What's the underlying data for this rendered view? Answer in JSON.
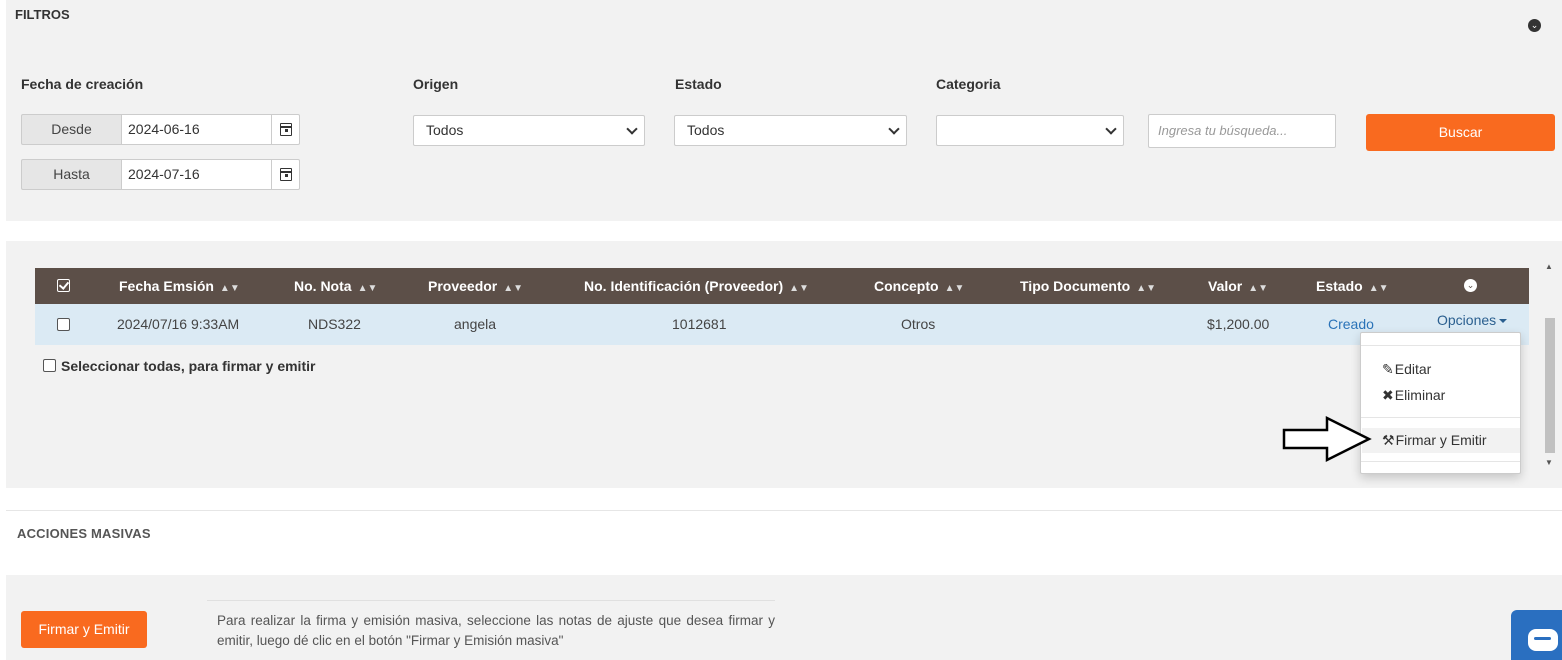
{
  "filters": {
    "title": "FILTROS",
    "fecha_label": "Fecha de creación",
    "desde_label": "Desde",
    "desde_value": "2024-06-16",
    "hasta_label": "Hasta",
    "hasta_value": "2024-07-16",
    "origen_label": "Origen",
    "origen_value": "Todos",
    "estado_label": "Estado",
    "estado_value": "Todos",
    "categoria_label": "Categoria",
    "categoria_value": "",
    "search_placeholder": "Ingresa tu búsqueda...",
    "buscar_label": "Buscar"
  },
  "table": {
    "columns": [
      "Fecha Emsión",
      "No. Nota",
      "Proveedor",
      "No. Identificación (Proveedor)",
      "Concepto",
      "Tipo Documento",
      "Valor",
      "Estado"
    ],
    "sort_glyph": "▲▼",
    "rows": [
      {
        "fecha": "2024/07/16 9:33AM",
        "nota": "NDS322",
        "proveedor": "angela",
        "identificacion": "1012681",
        "concepto": "Otros",
        "tipo": "",
        "valor": "$1,200.00",
        "estado": "Creado",
        "opciones": "Opciones"
      }
    ],
    "select_all_label": "Seleccionar todas, para firmar y emitir"
  },
  "dropdown": {
    "editar": "Editar",
    "eliminar": "Eliminar",
    "firmar": "Firmar y Emitir"
  },
  "acciones": {
    "title": "ACCIONES MASIVAS",
    "button_label": "Firmar y Emitir",
    "help_text": "Para realizar la firma y emisión masiva, seleccione las notas de ajuste que desea firmar y emitir, luego dé clic en el botón \"Firmar y Emisión masiva\""
  },
  "colors": {
    "accent": "#f96a1f",
    "table_header": "#5c4f48",
    "row_highlight": "#dbeaf4",
    "link": "#2a73b8",
    "chat": "#2a6fc0"
  }
}
